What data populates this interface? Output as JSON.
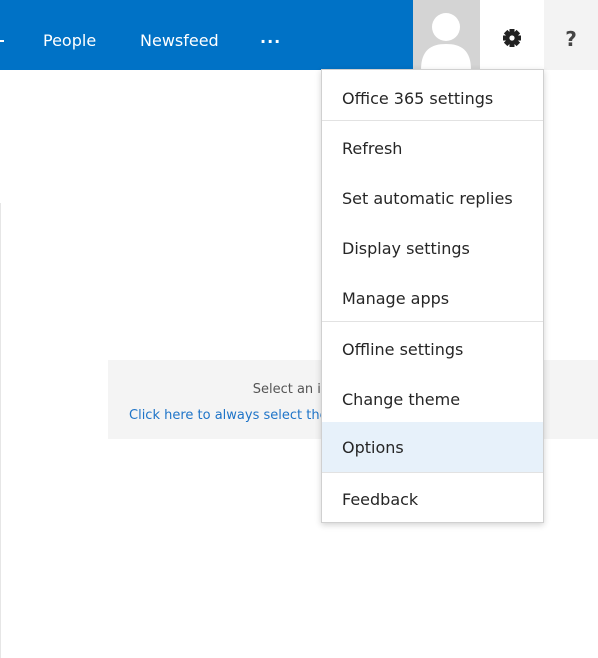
{
  "topbar": {
    "nav": [
      "People",
      "Newsfeed",
      "..."
    ],
    "help_label": "?",
    "accent_color": "#0072c6"
  },
  "icons": {
    "avatar": "user-silhouette-icon",
    "settings": "gear-icon",
    "help": "question-mark-icon"
  },
  "reading_pane": {
    "title": "Select an item to read",
    "link": "Click here to always select the first item in the list"
  },
  "settings_menu": {
    "items": [
      "Office 365 settings",
      "Refresh",
      "Set automatic replies",
      "Display settings",
      "Manage apps",
      "Offline settings",
      "Change theme",
      "Options",
      "Feedback"
    ],
    "selected": "Options"
  }
}
